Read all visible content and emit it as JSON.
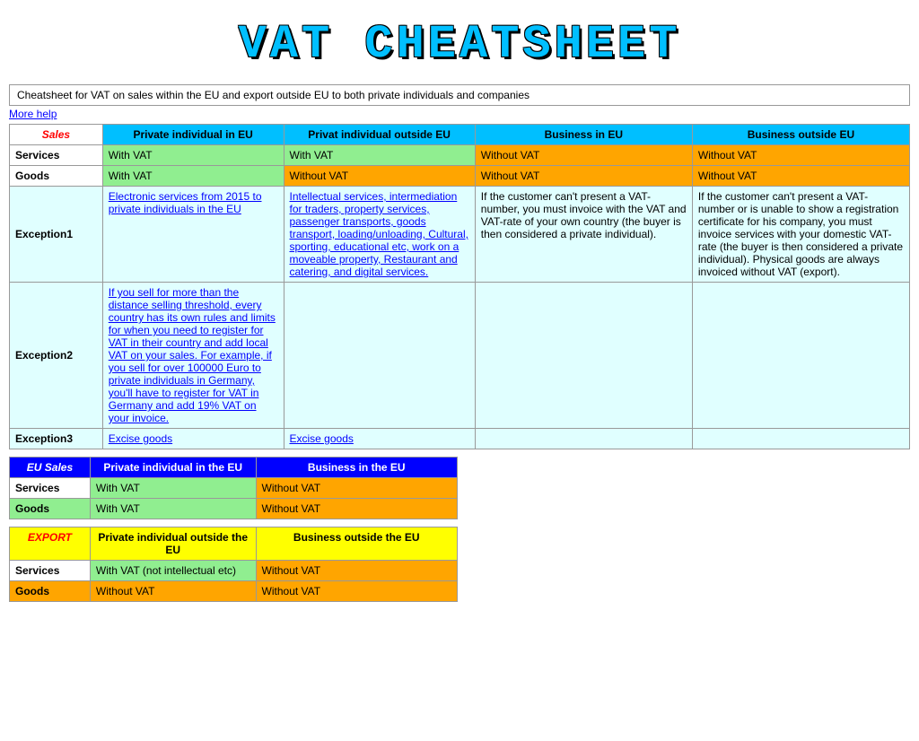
{
  "title": "VAT CHEATSHEET",
  "subtitle": "Cheatsheet for VAT on sales within the EU and export outside EU to both private individuals and companies",
  "more_help_label": "More help",
  "main_table": {
    "headers": [
      "Sales",
      "Private individual in EU",
      "Privat individual outside EU",
      "Business in EU",
      "Business outside EU"
    ],
    "services": {
      "label": "Services",
      "private_eu": "With VAT",
      "private_outside": "With VAT",
      "business_eu": "Without VAT",
      "business_outside": "Without VAT"
    },
    "goods": {
      "label": "Goods",
      "private_eu": "With VAT",
      "private_outside": "Without VAT",
      "business_eu": "Without VAT",
      "business_outside": "Without VAT"
    },
    "exception1": {
      "label": "Exception1",
      "private_eu": "Electronic services from 2015 to private individuals in the EU",
      "private_outside": "Intellectual services, intermediation for traders, property services, passenger transports, goods transport, loading/unloading, Cultural, sporting, educational etc, work on a moveable property, Restaurant and catering, and digital services.",
      "business_eu": "If the customer can't present a VAT-number, you must invoice with the VAT and VAT-rate of your own country (the buyer is then considered a private individual).",
      "business_outside": "If the customer can't present a VAT-number or is unable to show a registration certificate for his company, you must invoice services with your domestic VAT-rate (the buyer is then considered a private individual). Physical goods are always invoiced without VAT (export)."
    },
    "exception2": {
      "label": "Exception2",
      "private_eu": "If you sell for more than the distance selling threshold, every country has its own rules and limits for when you need to register for VAT in their country and add local VAT on your sales. For example, if you sell for over 100000 Euro to private individuals in Germany, you'll have to register for VAT in Germany and add 19% VAT on your invoice.",
      "private_outside": "",
      "business_eu": "",
      "business_outside": ""
    },
    "exception3": {
      "label": "Exception3",
      "private_eu": "Excise goods",
      "private_outside": "Excise goods",
      "business_eu": "",
      "business_outside": ""
    }
  },
  "eu_sales": {
    "header_col1": "EU Sales",
    "header_col2": "Private individual in the EU",
    "header_col3": "Business in the EU",
    "services_label": "Services",
    "services_col2": "With VAT",
    "services_col3": "Without VAT",
    "goods_label": "Goods",
    "goods_col2": "With VAT",
    "goods_col3": "Without VAT"
  },
  "export": {
    "header_col1": "EXPORT",
    "header_col2": "Private individual outside the EU",
    "header_col3": "Business outside the EU",
    "services_label": "Services",
    "services_col2": "With VAT (not intellectual etc)",
    "services_col3": "Without VAT",
    "goods_label": "Goods",
    "goods_col2": "Without VAT",
    "goods_col3": "Without VAT"
  }
}
